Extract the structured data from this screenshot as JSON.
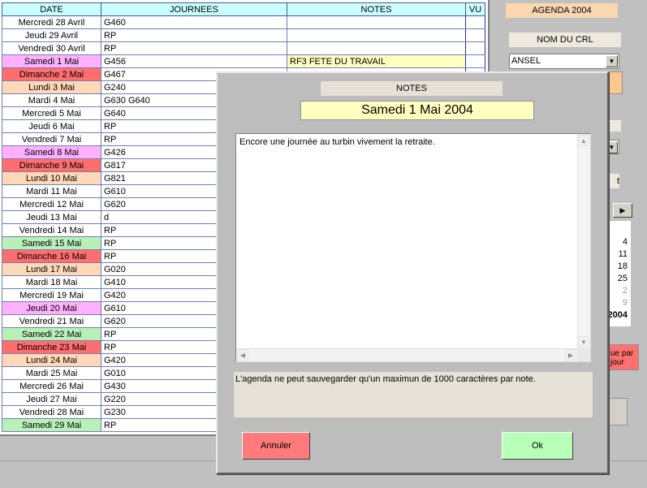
{
  "grid": {
    "headers": {
      "date": "DATE",
      "journees": "JOURNEES",
      "notes": "NOTES",
      "vu": "VU"
    },
    "rows": [
      {
        "date": "Mercredi 28 Avril",
        "journee": "G460",
        "note": "",
        "style": "weekday"
      },
      {
        "date": "Jeudi 29 Avril",
        "journee": "RP",
        "note": "",
        "style": "weekday"
      },
      {
        "date": "Vendredi 30 Avril",
        "journee": "RP",
        "note": "",
        "style": "weekday"
      },
      {
        "date": "Samedi 1 Mai",
        "journee": "G456",
        "note": "RF3 FETE DU TRAVAIL",
        "style": "sat"
      },
      {
        "date": "Dimanche 2 Mai",
        "journee": "G467",
        "note": "",
        "style": "sun"
      },
      {
        "date": "Lundi 3 Mai",
        "journee": "G240",
        "note": "",
        "style": "mon"
      },
      {
        "date": "Mardi 4 Mai",
        "journee": "G630 G640",
        "note": "",
        "style": "weekday"
      },
      {
        "date": "Mercredi 5 Mai",
        "journee": "G640",
        "note": "",
        "style": "weekday"
      },
      {
        "date": "Jeudi 6 Mai",
        "journee": "RP",
        "note": "",
        "style": "weekday"
      },
      {
        "date": "Vendredi 7 Mai",
        "journee": "RP",
        "note": "",
        "style": "weekday"
      },
      {
        "date": "Samedi 8 Mai",
        "journee": "G426",
        "note": "",
        "style": "sat"
      },
      {
        "date": "Dimanche 9 Mai",
        "journee": "G817",
        "note": "",
        "style": "sun"
      },
      {
        "date": "Lundi 10 Mai",
        "journee": "G821",
        "note": "",
        "style": "mon"
      },
      {
        "date": "Mardi 11 Mai",
        "journee": "G610",
        "note": "",
        "style": "weekday"
      },
      {
        "date": "Mercredi 12 Mai",
        "journee": "G620",
        "note": "",
        "style": "weekday"
      },
      {
        "date": "Jeudi 13 Mai",
        "journee": "d",
        "note": "",
        "style": "weekday"
      },
      {
        "date": "Vendredi 14 Mai",
        "journee": "RP",
        "note": "",
        "style": "weekday"
      },
      {
        "date": "Samedi 15 Mai",
        "journee": "RP",
        "note": "",
        "style": "satg"
      },
      {
        "date": "Dimanche 16 Mai",
        "journee": "RP",
        "note": "",
        "style": "sun"
      },
      {
        "date": "Lundi 17 Mai",
        "journee": "G020",
        "note": "",
        "style": "mon"
      },
      {
        "date": "Mardi 18 Mai",
        "journee": "G410",
        "note": "",
        "style": "weekday"
      },
      {
        "date": "Mercredi 19 Mai",
        "journee": "G420",
        "note": "",
        "style": "weekday"
      },
      {
        "date": "Jeudi 20 Mai",
        "journee": "G610",
        "note": "",
        "style": "sat"
      },
      {
        "date": "Vendredi 21 Mai",
        "journee": "G620",
        "note": "",
        "style": "weekday"
      },
      {
        "date": "Samedi 22 Mai",
        "journee": "RP",
        "note": "",
        "style": "satg"
      },
      {
        "date": "Dimanche 23 Mai",
        "journee": "RP",
        "note": "",
        "style": "sun"
      },
      {
        "date": "Lundi 24 Mai",
        "journee": "G420",
        "note": "",
        "style": "mon"
      },
      {
        "date": "Mardi 25 Mai",
        "journee": "G010",
        "note": "",
        "style": "weekday"
      },
      {
        "date": "Mercredi 26 Mai",
        "journee": "G430",
        "note": "",
        "style": "weekday"
      },
      {
        "date": "Jeudi 27 Mai",
        "journee": "G220",
        "note": "",
        "style": "weekday"
      },
      {
        "date": "Vendredi 28 Mai",
        "journee": "G230",
        "note": "",
        "style": "weekday"
      },
      {
        "date": "Samedi 29 Mai",
        "journee": "RP",
        "note": "",
        "style": "satg"
      }
    ]
  },
  "right_panel": {
    "agenda_title": "AGENDA 2004",
    "crl_label": "NOM DU CRL",
    "crl_value": "ANSEL",
    "strip_t": "t",
    "cal_numbers": [
      {
        "text": "4",
        "style": "normal"
      },
      {
        "text": "11",
        "style": "normal"
      },
      {
        "text": "18",
        "style": "normal"
      },
      {
        "text": "25",
        "style": "normal"
      },
      {
        "text": "2",
        "style": "dim"
      },
      {
        "text": "9",
        "style": "dim"
      },
      {
        "text": "2004",
        "style": "bold"
      }
    ],
    "red_button": "ue par jour"
  },
  "modal": {
    "title": "NOTES",
    "date": "Samedi 1 Mai 2004",
    "note_text": "Encore une journée au turbin vivement la retraite.",
    "info": "L'agenda ne peut sauvegarder qu'un maximun de 1000 caractères par note.",
    "cancel_label": "Annuler",
    "ok_label": "Ok"
  },
  "colors": {
    "header": "#ccffff",
    "saturday": "#ffb0ff",
    "sunday": "#ff6e6e",
    "monday": "#ffd8b8",
    "saturday_green": "#b8f0b8",
    "note_highlight": "#ffffc0",
    "cancel": "#ff7a7a",
    "ok": "#b8ffb8"
  }
}
